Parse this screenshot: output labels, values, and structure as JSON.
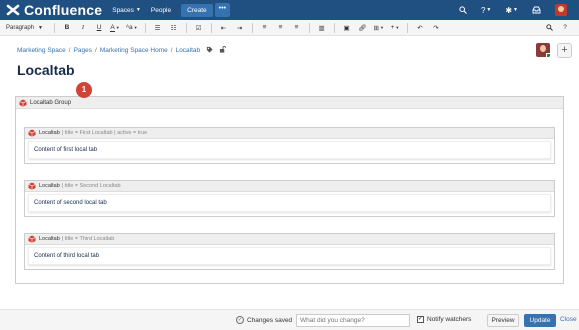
{
  "topnav": {
    "brand": "Confluence",
    "spaces": "Spaces",
    "people": "People",
    "create": "Create",
    "more": "•••"
  },
  "toolbar": {
    "paragraph": "Paragraph"
  },
  "breadcrumb": [
    "Marketing Space",
    "Pages",
    "Marketing Space Home",
    "Localtab"
  ],
  "page": {
    "title": "Localtab"
  },
  "group": {
    "label": "Localtab Group",
    "badge": "1"
  },
  "tabs": [
    {
      "name": "Localtab",
      "params": "| title = First Localtab | active = true",
      "content": "Content of first local tab"
    },
    {
      "name": "Localtab",
      "params": "| title = Second Localtab",
      "content": "Content of second local tab"
    },
    {
      "name": "Localtab",
      "params": "| title = Third Localtab",
      "content": "Content of third local tab"
    }
  ],
  "footer": {
    "saved": "Changes saved",
    "change_placeholder": "What did you change?",
    "notify": "Notify watchers",
    "preview": "Preview",
    "update": "Update",
    "close": "Close"
  },
  "colors": {
    "nav_bg": "#205081",
    "accent": "#3572b0",
    "macro_red": "#d04437"
  }
}
